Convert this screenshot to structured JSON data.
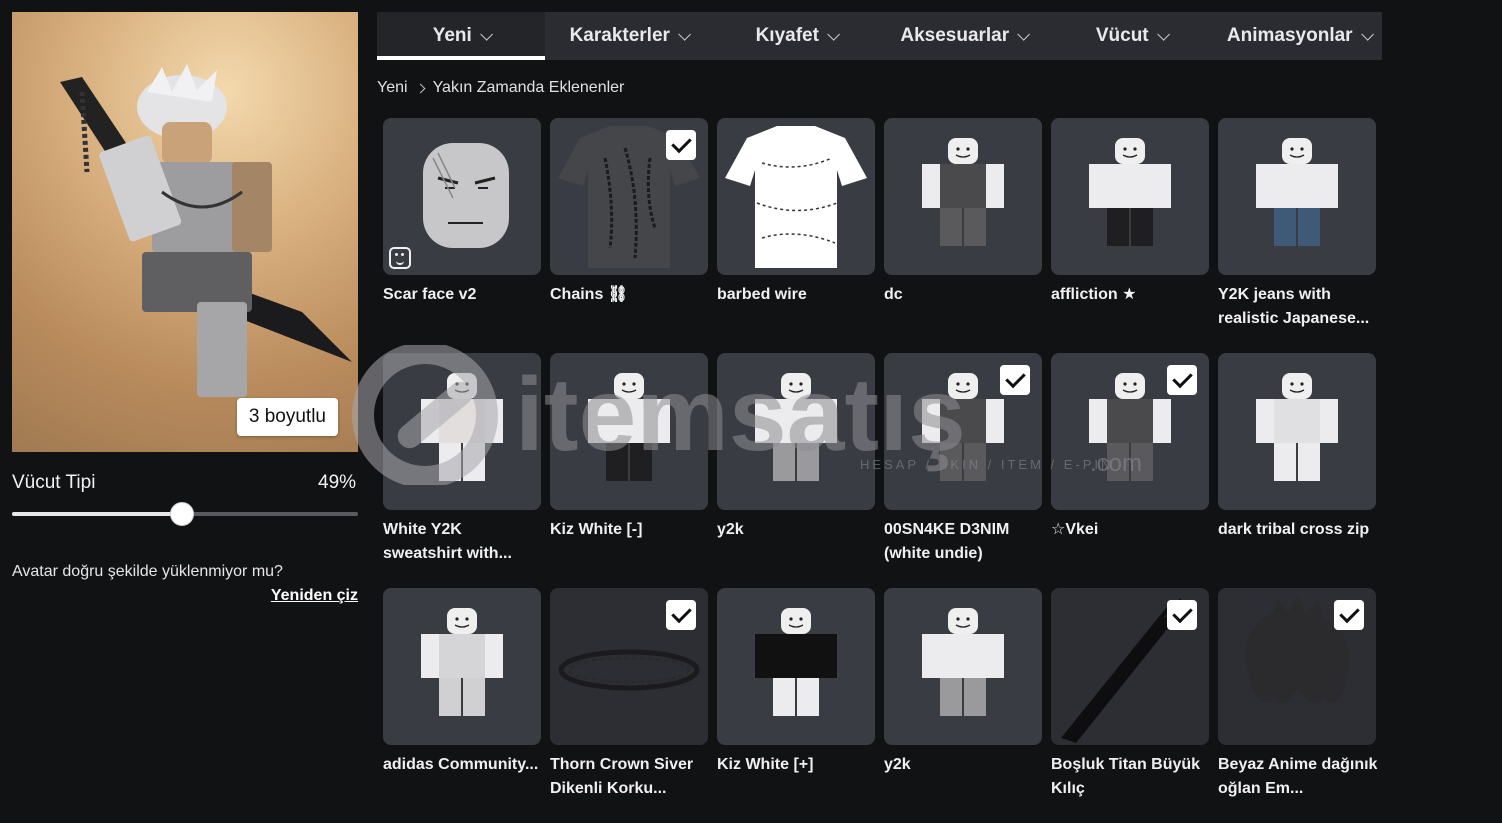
{
  "avatar": {
    "view_toggle_label": "3 boyutlu",
    "body_type_label": "Vücut Tipi",
    "body_type_value": "49%",
    "body_type_level": 0.49,
    "load_question": "Avatar doğru şekilde yüklenmiyor mu?",
    "redraw_label": "Yeniden çiz"
  },
  "nav": {
    "tabs": [
      {
        "label": "Yeni",
        "active": true
      },
      {
        "label": "Karakterler"
      },
      {
        "label": "Kıyafet"
      },
      {
        "label": "Aksesuarlar"
      },
      {
        "label": "Vücut"
      },
      {
        "label": "Animasyonlar"
      }
    ]
  },
  "breadcrumb": {
    "root": "Yeni",
    "current": "Yakın Zamanda Eklenenler"
  },
  "items": [
    {
      "name": "Scar face v2",
      "checked": false,
      "art": "face",
      "badge": true
    },
    {
      "name": "Chains ⛓",
      "checked": true,
      "art": "dark-shirt"
    },
    {
      "name": "barbed wire",
      "checked": false,
      "art": "white-shirt"
    },
    {
      "name": "dc",
      "checked": false,
      "art": "avatar-dark"
    },
    {
      "name": "affliction ★",
      "checked": false,
      "art": "avatar-shorts"
    },
    {
      "name": "Y2K jeans with realistic Japanese...",
      "checked": false,
      "art": "avatar-jeans"
    },
    {
      "name": "White Y2K sweatshirt with...",
      "checked": false,
      "art": "avatar-white"
    },
    {
      "name": "Kiz White [-]",
      "checked": false,
      "art": "avatar-shorts"
    },
    {
      "name": "y2k",
      "checked": false,
      "art": "avatar-grey-pants"
    },
    {
      "name": "00SN4KE D3NIM (white undie)",
      "checked": true,
      "art": "avatar-dark"
    },
    {
      "name": "☆Vkei",
      "checked": true,
      "art": "avatar-dark"
    },
    {
      "name": "dark tribal cross zip",
      "checked": false,
      "art": "avatar-tribal"
    },
    {
      "name": "adidas Community...",
      "checked": false,
      "art": "avatar-grey"
    },
    {
      "name": "Thorn Crown Siver Dikenli Korku...",
      "checked": true,
      "art": "crown"
    },
    {
      "name": "Kiz White [+]",
      "checked": false,
      "art": "avatar-black-top"
    },
    {
      "name": "y2k",
      "checked": false,
      "art": "avatar-grey-pants"
    },
    {
      "name": "Boşluk Titan Büyük Kılıç",
      "checked": true,
      "art": "sword"
    },
    {
      "name": "Beyaz Anime dağınık oğlan Em...",
      "checked": true,
      "art": "hair"
    }
  ],
  "watermark": {
    "brand": "itemsatış",
    "tagline": "HESAP / SKIN / ITEM / E-PIN",
    "suffix": ".com"
  }
}
